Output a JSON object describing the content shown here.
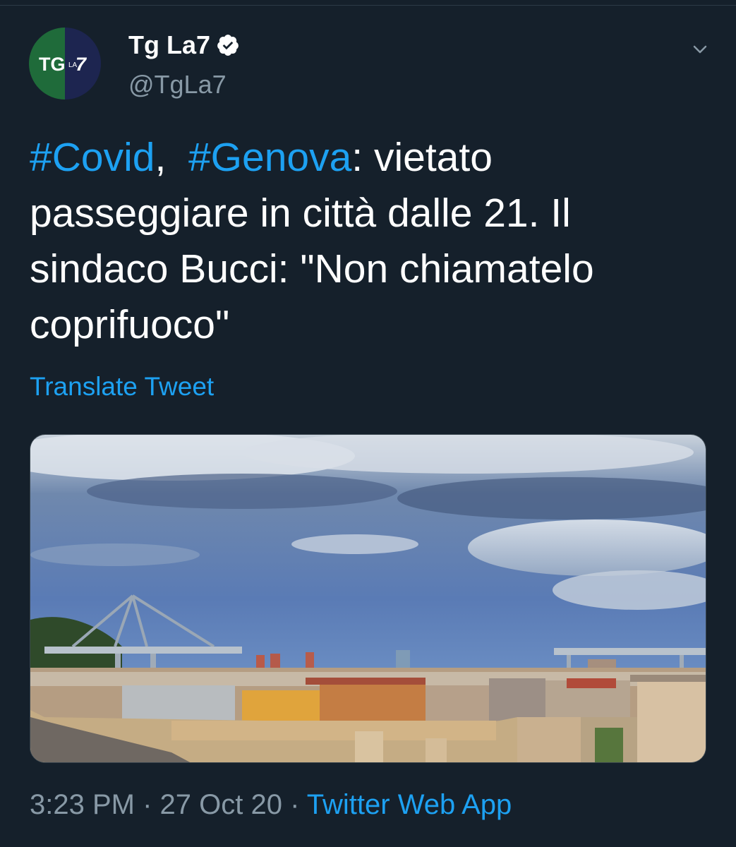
{
  "author": {
    "name": "Tg La7",
    "handle": "@TgLa7",
    "verified": true,
    "avatar": {
      "logo_text_main": "TG",
      "logo_text_small": "LA",
      "logo_text_num": "7",
      "left_color": "#1f6b3a",
      "right_color": "#1d2550"
    }
  },
  "tweet": {
    "hashtag_1": "#Covid",
    "separator_1": ",  ",
    "hashtag_2": "#Genova",
    "body": ": vietato passeggiare in città dalle 21. Il sindaco Bucci: \"Non chiamatelo coprifuoco\"",
    "translate_label": "Translate Tweet"
  },
  "media": {
    "icon": "photo-image"
  },
  "meta": {
    "time": "3:23 PM",
    "dot_1": " · ",
    "date": "27 Oct 20",
    "dot_2": " · ",
    "source": "Twitter Web App"
  },
  "colors": {
    "background": "#15202b",
    "accent": "#1da1f2",
    "secondary_text": "#8899a6"
  }
}
